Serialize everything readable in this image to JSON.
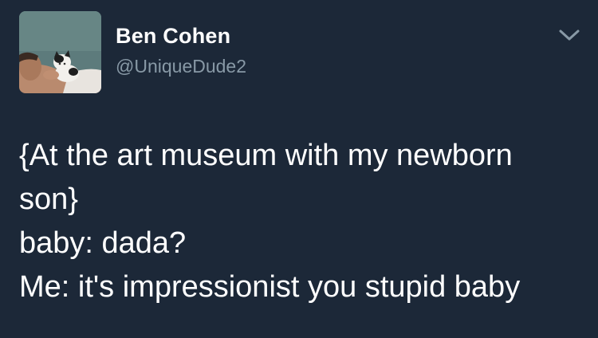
{
  "tweet": {
    "author": {
      "display_name": "Ben Cohen",
      "handle": "@UniqueDude2",
      "avatar_icon": "profile-photo"
    },
    "menu_icon": "chevron-down-icon",
    "text_lines": [
      "{At the art museum with my newborn",
      "son}",
      "baby: dada?",
      "Me: it's impressionist you stupid baby"
    ]
  },
  "colors": {
    "background": "#1c2838",
    "primary_text": "#ffffff",
    "secondary_text": "#8899a6",
    "chevron": "#8899a6"
  }
}
